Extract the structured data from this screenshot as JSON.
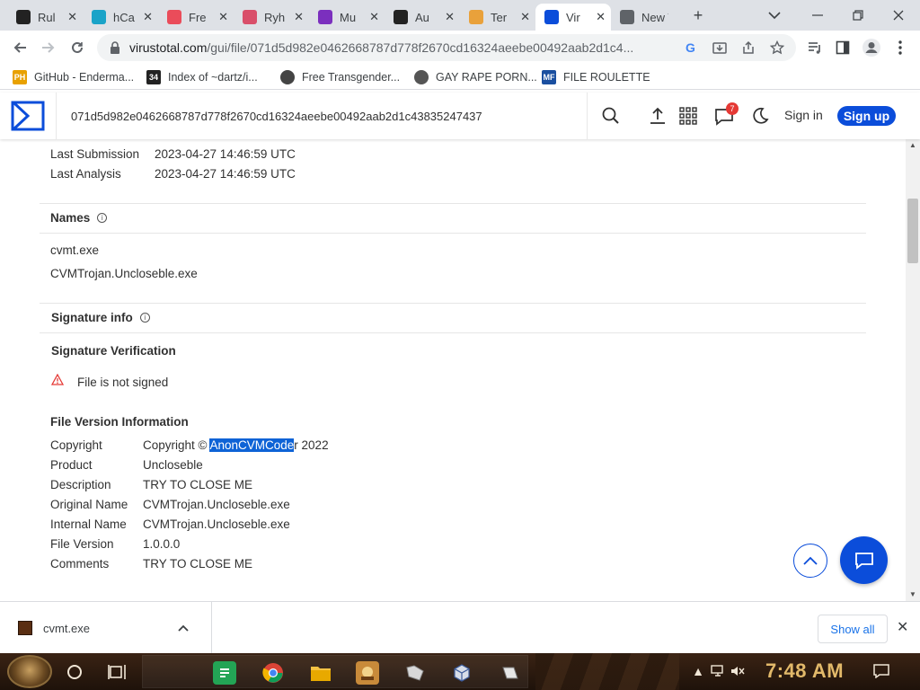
{
  "browser": {
    "tabs": [
      {
        "title": "Rul",
        "favicon": "site-34-icon",
        "color": "#222222"
      },
      {
        "title": "hCa",
        "favicon": "hc-icon",
        "color": "#1aa3c8"
      },
      {
        "title": "Fre",
        "favicon": "fre-icon",
        "color": "#ea4c5a"
      },
      {
        "title": "Ryh",
        "favicon": "ryh-icon",
        "color": "#d94f6a"
      },
      {
        "title": "Mu",
        "favicon": "patreon-icon",
        "color": "#7b2fbe"
      },
      {
        "title": "Au",
        "favicon": "amazon-icon",
        "color": "#222222"
      },
      {
        "title": "Ter",
        "favicon": "ter-icon",
        "color": "#e9a13b"
      },
      {
        "title": "Vir",
        "favicon": "virustotal-icon",
        "color": "#0b4dda"
      },
      {
        "title": "New Ta",
        "favicon": "chrome-icon",
        "color": "#5f6368"
      }
    ],
    "active_tab_index": 7,
    "new_tab_glyph": "+",
    "url_host": "virustotal.com",
    "url_path": "/gui/file/071d5d982e0462668787d778f2670cd16324aeebe00492aab2d1c4...",
    "bookmarks": [
      {
        "label": "GitHub - Enderma...",
        "icon": "PH",
        "color": "#e8a100"
      },
      {
        "label": "Index of ~dartz/i...",
        "icon": "34",
        "color": "#222222"
      },
      {
        "label": "Free Transgender...",
        "icon": "",
        "color": "#444444"
      },
      {
        "label": "GAY RAPE PORN...",
        "icon": "",
        "color": "#555555"
      },
      {
        "label": "FILE ROULETTE",
        "icon": "MF",
        "color": "#1a4fa0"
      }
    ]
  },
  "site": {
    "search_value": "071d5d982e0462668787d778f2670cd16324aeebe00492aab2d1c43835247437",
    "notification_count": "7",
    "signin": "Sign in",
    "signup": "Sign up"
  },
  "details": {
    "last_submission_label": "Last Submission",
    "last_submission_value": "2023-04-27 14:46:59 UTC",
    "last_analysis_label": "Last Analysis",
    "last_analysis_value": "2023-04-27 14:46:59 UTC",
    "names_title": "Names",
    "names": [
      "cvmt.exe",
      "CVMTrojan.Uncloseble.exe"
    ],
    "signature_info_title": "Signature info",
    "signature_verification_title": "Signature Verification",
    "not_signed": "File is not signed",
    "file_version_title": "File Version Information",
    "version_rows": [
      {
        "label": "Copyright",
        "value": "Copyright © AnonCVMCoder 2022"
      },
      {
        "label": "Product",
        "value": "Uncloseble"
      },
      {
        "label": "Description",
        "value": "TRY TO CLOSE ME"
      },
      {
        "label": "Original Name",
        "value": "CVMTrojan.Uncloseble.exe"
      },
      {
        "label": "Internal Name",
        "value": "CVMTrojan.Uncloseble.exe"
      },
      {
        "label": "File Version",
        "value": "1.0.0.0"
      },
      {
        "label": "Comments",
        "value": "TRY TO CLOSE ME"
      }
    ],
    "copyright_prefix": "Copyright © ",
    "copyright_selected": "AnonCVMCode",
    "copyright_suffix": "r 2022"
  },
  "download_bar": {
    "file_name": "cvmt.exe",
    "show_all": "Show all"
  },
  "taskbar": {
    "clock": "7:48 AM"
  }
}
